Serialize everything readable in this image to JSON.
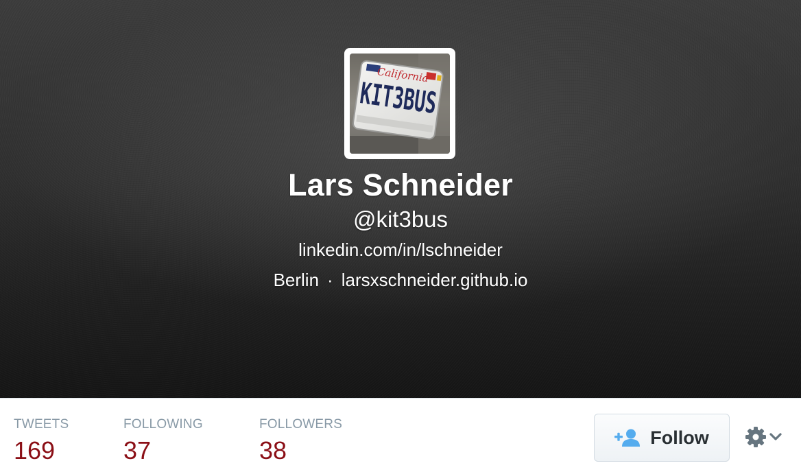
{
  "profile": {
    "name": "Lars Schneider",
    "screen_name": "@kit3bus",
    "bio_url": "linkedin.com/in/lschneider",
    "location": "Berlin",
    "separator": "·",
    "website": "larsxschneider.github.io",
    "avatar_plate_state": "California",
    "avatar_plate_text": "KIT3BUS"
  },
  "stats": [
    {
      "label": "TWEETS",
      "value": "169"
    },
    {
      "label": "FOLLOWING",
      "value": "37"
    },
    {
      "label": "FOLLOWERS",
      "value": "38"
    }
  ],
  "actions": {
    "follow_label": "Follow",
    "follow_icon": "add-user-icon",
    "settings_icon": "gear-icon",
    "settings_chevron": "chevron-down-icon"
  },
  "colors": {
    "stat_value": "#8b0f16",
    "stat_label": "#8899a6",
    "follow_icon": "#55acee",
    "gear": "#66757f"
  }
}
